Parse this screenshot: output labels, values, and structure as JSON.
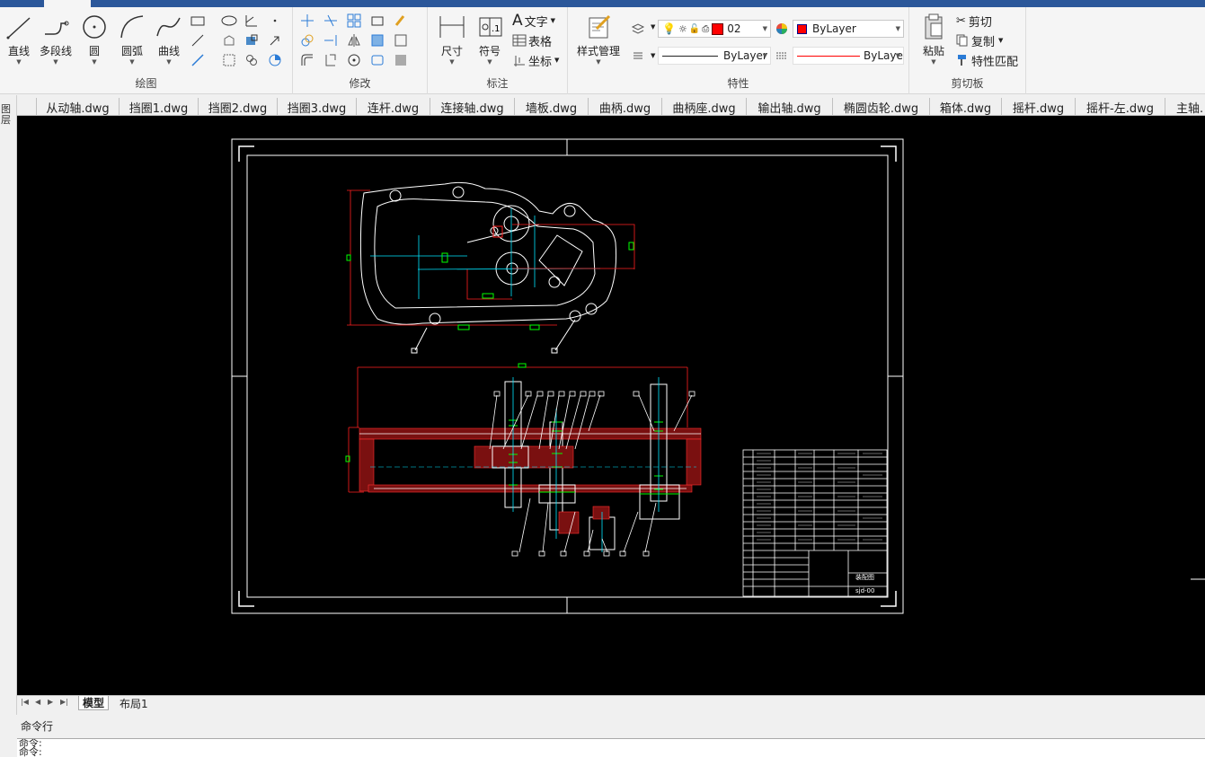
{
  "ribbon": {
    "draw": {
      "group_label": "绘图",
      "line": "直线",
      "polyline": "多段线",
      "circle": "圆",
      "arc": "圆弧",
      "curve": "曲线"
    },
    "modify": {
      "group_label": "修改"
    },
    "annotate": {
      "group_label": "标注",
      "dimension": "尺寸",
      "symbol": "符号",
      "text": "文字",
      "table": "表格",
      "coordinate": "坐标"
    },
    "properties": {
      "group_label": "特性",
      "style_manager": "样式管理",
      "layer_value": "02",
      "color_value": "ByLayer",
      "linetype_value": "ByLayer",
      "lineweight_value": "ByLaye",
      "accent_red": "#ff0000"
    },
    "clipboard": {
      "group_label": "剪切板",
      "paste": "粘贴",
      "cut": "剪切",
      "copy": "复制",
      "match_props": "特性匹配"
    }
  },
  "file_tabs": [
    "从动轴.dwg",
    "挡圈1.dwg",
    "挡圈2.dwg",
    "挡圈3.dwg",
    "连杆.dwg",
    "连接轴.dwg",
    "墙板.dwg",
    "曲柄.dwg",
    "曲柄座.dwg",
    "输出轴.dwg",
    "椭圆齿轮.dwg",
    "箱体.dwg",
    "摇杆.dwg",
    "摇杆-左.dwg",
    "主轴."
  ],
  "left_panel": {
    "label": "图层"
  },
  "layout_tabs": {
    "model": "模型",
    "layout1": "布局1"
  },
  "command": {
    "title": "命令行",
    "history": [
      "命令:",
      "命令:"
    ]
  },
  "title_block": {
    "name": "装配图",
    "code": "sjd-00"
  }
}
